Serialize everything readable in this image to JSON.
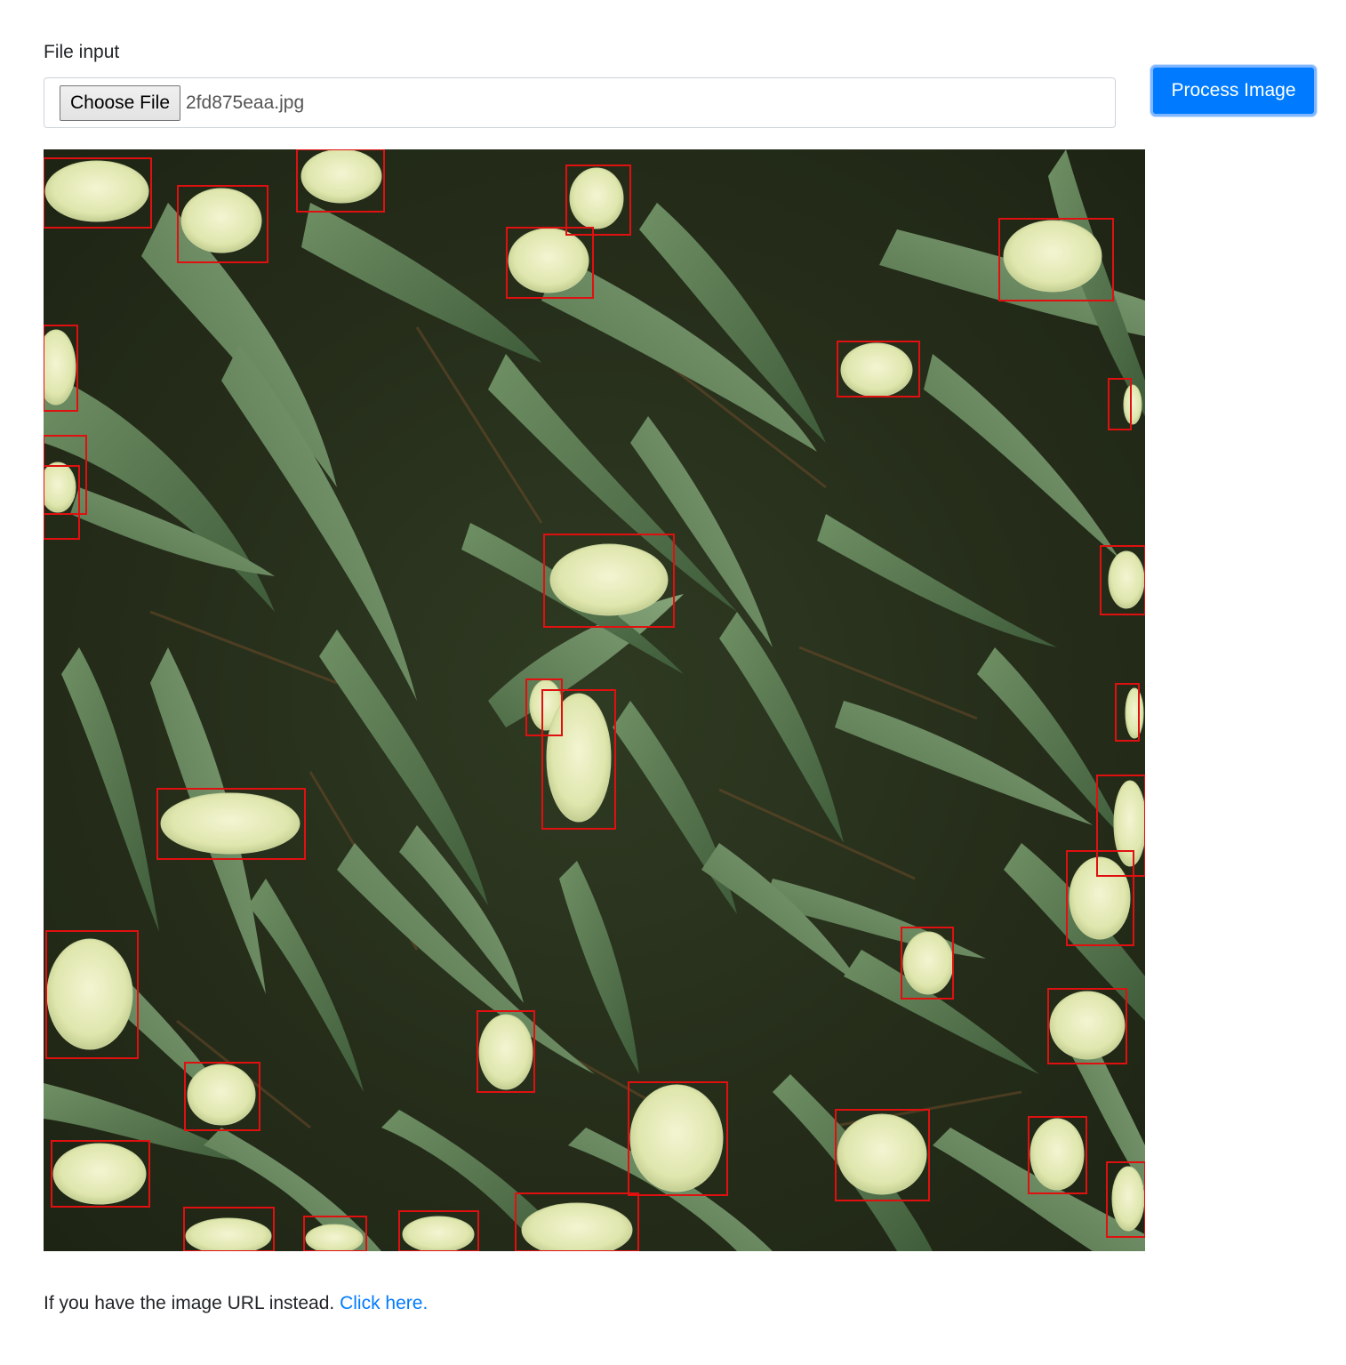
{
  "file_input": {
    "label": "File input",
    "choose_button": "Choose File",
    "selected_file": "2fd875eaa.jpg"
  },
  "process_button": "Process Image",
  "detection_image": {
    "box_color": "#e01010",
    "detected_object": "wheat head"
  },
  "footer": {
    "text": "If you have the image URL instead.",
    "link": "Click here."
  }
}
